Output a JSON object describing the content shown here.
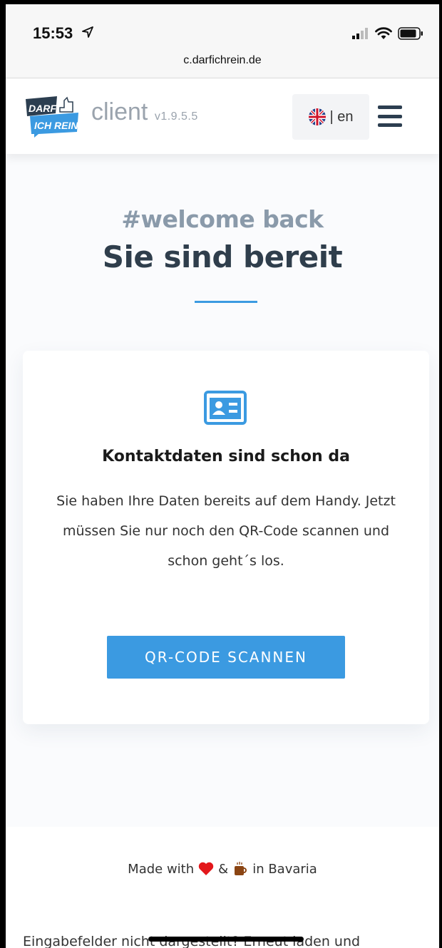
{
  "status_bar": {
    "time": "15:53",
    "url": "c.darfichrein.de"
  },
  "header": {
    "logo_text_top": "DARF",
    "logo_text_bottom": "ICH REIN",
    "client_label": "client",
    "version": "v1.9.5.5",
    "language_label": "| en"
  },
  "main": {
    "welcome": "#welcome back",
    "title": "Sie sind bereit",
    "card": {
      "heading": "Kontaktdaten sind schon da",
      "text": "Sie haben Ihre Daten bereits auf dem Handy. Jetzt müssen Sie nur noch den QR-Code scannen und schon geht´s los.",
      "button_label": "QR-CODE SCANNEN"
    }
  },
  "footer": {
    "made_with_prefix": "Made with",
    "made_with_amp": "&",
    "made_with_suffix": "in Bavaria",
    "reload_hint": "Eingabefelder nicht dargestellt? Erneut laden und"
  },
  "colors": {
    "accent": "#3b9ae1",
    "title": "#2f3e4c",
    "subtitle": "#8a9aaa"
  }
}
